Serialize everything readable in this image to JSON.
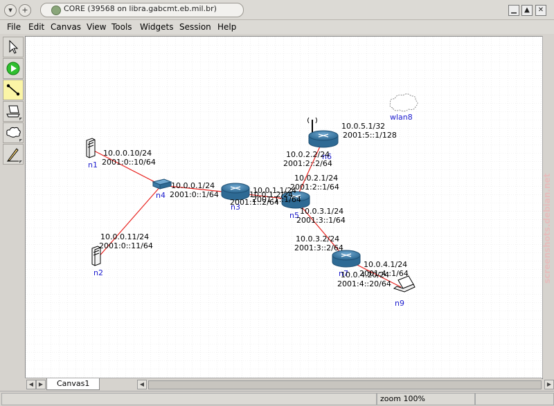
{
  "window": {
    "title": "CORE (39568 on libra.gabcmt.eb.mil.br)",
    "btn_down": "▾",
    "btn_plus": "+",
    "ctrl_min": "▁",
    "ctrl_max": "▲",
    "ctrl_close": "✕"
  },
  "menu": [
    "File",
    "Edit",
    "Canvas",
    "View",
    "Tools",
    "Widgets",
    "Session",
    "Help"
  ],
  "toolbar": [
    "select-tool",
    "start-session",
    "link-tool",
    "network-node",
    "link-layer-node",
    "marker-tool"
  ],
  "nodes": {
    "n1": "n1",
    "n2": "n2",
    "n3": "n3",
    "n4": "n4",
    "n5": "n5",
    "n6": "n6",
    "n7": "n7",
    "n9": "n9",
    "wlan8": "wlan8"
  },
  "labels": {
    "n1_v4": "10.0.0.10/24",
    "n1_v6": "2001:0::10/64",
    "n2_v4": "10.0.0.11/24",
    "n2_v6": "2001:0::11/64",
    "n3_v4": "10.0.0.1/24",
    "n3_v6": "2001:0::1/64",
    "n3_n5_v4a": "10.0.1.1/24",
    "n3_n5_v4b": "10.0.1.2/24",
    "n3_n5_v6a": "2001:1::1/64",
    "n3_n5_v6b": "2001:1::2/64",
    "n5_n6_v4": "10.0.2.1/24",
    "n5_n6_v6": "2001:2::1/64",
    "n6_n5_v4": "10.0.2.2/24",
    "n6_n5_v6": "2001:2::2/64",
    "n6_v4": "10.0.5.1/32",
    "n6_v6": "2001:5::1/128",
    "n5_n7_v4": "10.0.3.1/24",
    "n5_n7_v6": "2001:3::1/64",
    "n7_n5_v4": "10.0.3.2/24",
    "n7_n5_v6": "2001:3::2/64",
    "n7_n9_v4": "10.0.4.1/24",
    "n7_n9_v6": "2001:4::1/64",
    "n9_v4": "10.0.4.20/24",
    "n9_v6": "2001:4::20/64"
  },
  "tab": {
    "canvas": "Canvas1"
  },
  "status": {
    "zoom": "zoom 100%"
  },
  "watermark": "screenshots.debian.net",
  "colors": {
    "link": "#e8201c",
    "router": "#3b7aa6",
    "node_label": "#1a1acd",
    "grid": "#c9c9c9"
  }
}
